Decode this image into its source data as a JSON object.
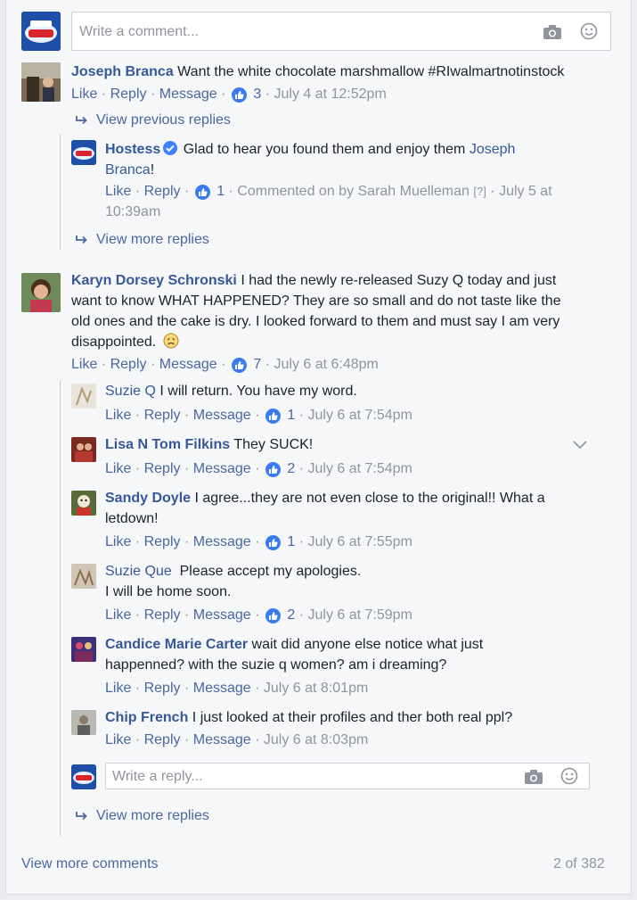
{
  "composer": {
    "placeholder": "Write a comment..."
  },
  "actions": {
    "like": "Like",
    "reply": "Reply",
    "message": "Message",
    "dot": "·"
  },
  "comments": [
    {
      "author": "Joseph Branca",
      "text": "Want the white chocolate marshmallow #RIwalmartnotinstock",
      "likes": "3",
      "time": "July 4 at 12:52pm",
      "view_previous": "View previous replies",
      "replies": [
        {
          "author": "Hostess",
          "text": "Glad to hear you found them and enjoy them",
          "mention": "Joseph",
          "mention2": "Branca",
          "text_end": "!",
          "likes": "1",
          "commented_on_by": "Commented on by Sarah Muelleman",
          "help": "[?]",
          "time_a": "July 5 at",
          "time_b": "10:39am"
        }
      ],
      "view_more": "View more replies"
    },
    {
      "author": "Karyn Dorsey Schronski",
      "text_lines": [
        "I had the newly re-released Suzy Q today and just",
        "want to know WHAT HAPPENED? They are so small and do not taste like the",
        "old ones and the cake is dry. I looked forward to them and must say I am very",
        "disappointed."
      ],
      "likes": "7",
      "time": "July 6 at 6:48pm",
      "replies": [
        {
          "author": "Suzie Q",
          "text": "I will return. You have my word.",
          "likes": "1",
          "time": "July 6 at 7:54pm"
        },
        {
          "author": "Lisa N Tom Filkins",
          "text": "They SUCK!",
          "likes": "2",
          "time": "July 6 at 7:54pm"
        },
        {
          "author": "Sandy Doyle",
          "text_a": "I agree...they are not even close to the original!! What a",
          "text_b": "letdown!",
          "likes": "1",
          "time": "July 6 at 7:55pm"
        },
        {
          "author": "Suzie Que",
          "text_a": "Please accept my apologies.",
          "text_b": "I will be home soon.",
          "likes": "2",
          "time": "July 6 at 7:59pm"
        },
        {
          "author": "Candice Marie Carter",
          "text_a": "wait did anyone else notice what just",
          "text_b": "happenned? with the suzie q women? am i dreaming?",
          "time": "July 6 at 8:01pm"
        },
        {
          "author": "Chip French",
          "text": "I just looked at their profiles and ther both real ppl?",
          "time": "July 6 at 8:03pm"
        }
      ],
      "reply_placeholder": "Write a reply...",
      "view_more": "View more replies"
    }
  ],
  "footer": {
    "view_more_comments": "View more comments",
    "count": "2 of 382"
  },
  "colors": {
    "name": "#365899",
    "meta": "#90949c",
    "like_badge": "#3b7bf0"
  }
}
